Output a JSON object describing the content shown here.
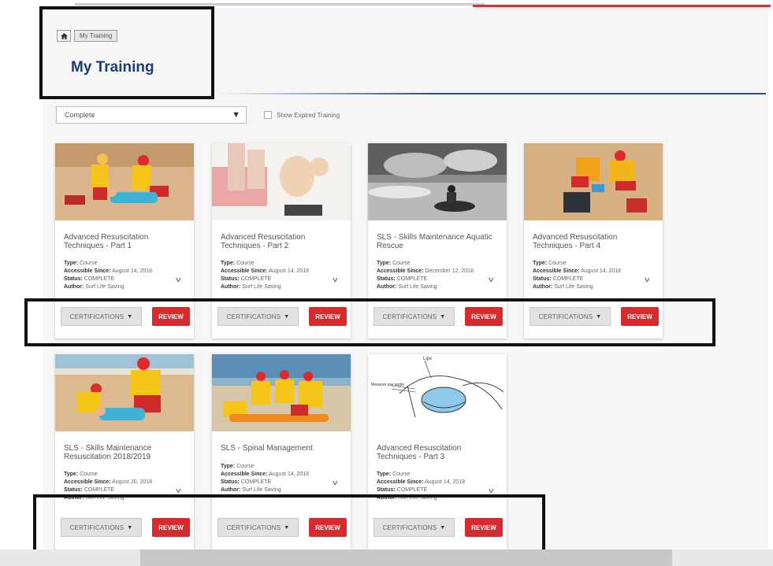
{
  "breadcrumb": {
    "home_icon": "home-icon",
    "current": "My Training"
  },
  "page_title": "My Training",
  "filter": {
    "selected": "Complete",
    "show_expired_label": "Show Expired Training"
  },
  "labels": {
    "type": "Type:",
    "accessible_since": "Accessible Since:",
    "status": "Status:",
    "author": "Author:",
    "certifications": "CERTIFICATIONS",
    "review": "REVIEW"
  },
  "courses": [
    {
      "title": "Advanced Resuscitation Techniques - Part 1",
      "type": "Course",
      "accessible_since": "August 14, 2018",
      "status": "COMPLETE",
      "author": "Surf Life Saving"
    },
    {
      "title": "Advanced Resuscitation Techniques - Part 2",
      "type": "Course",
      "accessible_since": "August 14, 2018",
      "status": "COMPLETE",
      "author": "Surf Life Saving"
    },
    {
      "title": "SLS - Skills Maintenance Aquatic Rescue",
      "type": "Course",
      "accessible_since": "December 12, 2018",
      "status": "COMPLETE",
      "author": "Surf Life Saving"
    },
    {
      "title": "Advanced Resuscitation Techniques - Part 4",
      "type": "Course",
      "accessible_since": "August 14, 2018",
      "status": "COMPLETE",
      "author": "Surf Life Saving"
    },
    {
      "title": "SLS - Skills Maintenance Resuscitation 2018/2019",
      "type": "Course",
      "accessible_since": "August 20, 2018",
      "status": "COMPLETE",
      "author": "Surf Life Saving"
    },
    {
      "title": "SLS - Spinal Management",
      "type": "Course",
      "accessible_since": "August 14, 2018",
      "status": "COMPLETE",
      "author": "Surf Life Saving"
    },
    {
      "title": "Advanced Resuscitation Techniques - Part 3",
      "type": "Course",
      "accessible_since": "August 14, 2018",
      "status": "COMPLETE",
      "author": "Surf Life Saving"
    }
  ],
  "diagram_labels": {
    "lips": "Lips",
    "measure": "Measure jaw angle"
  },
  "colors": {
    "title": "#1b3f73",
    "review": "#d62c30",
    "rule": "#224e92",
    "top_red": "#c8393c"
  }
}
